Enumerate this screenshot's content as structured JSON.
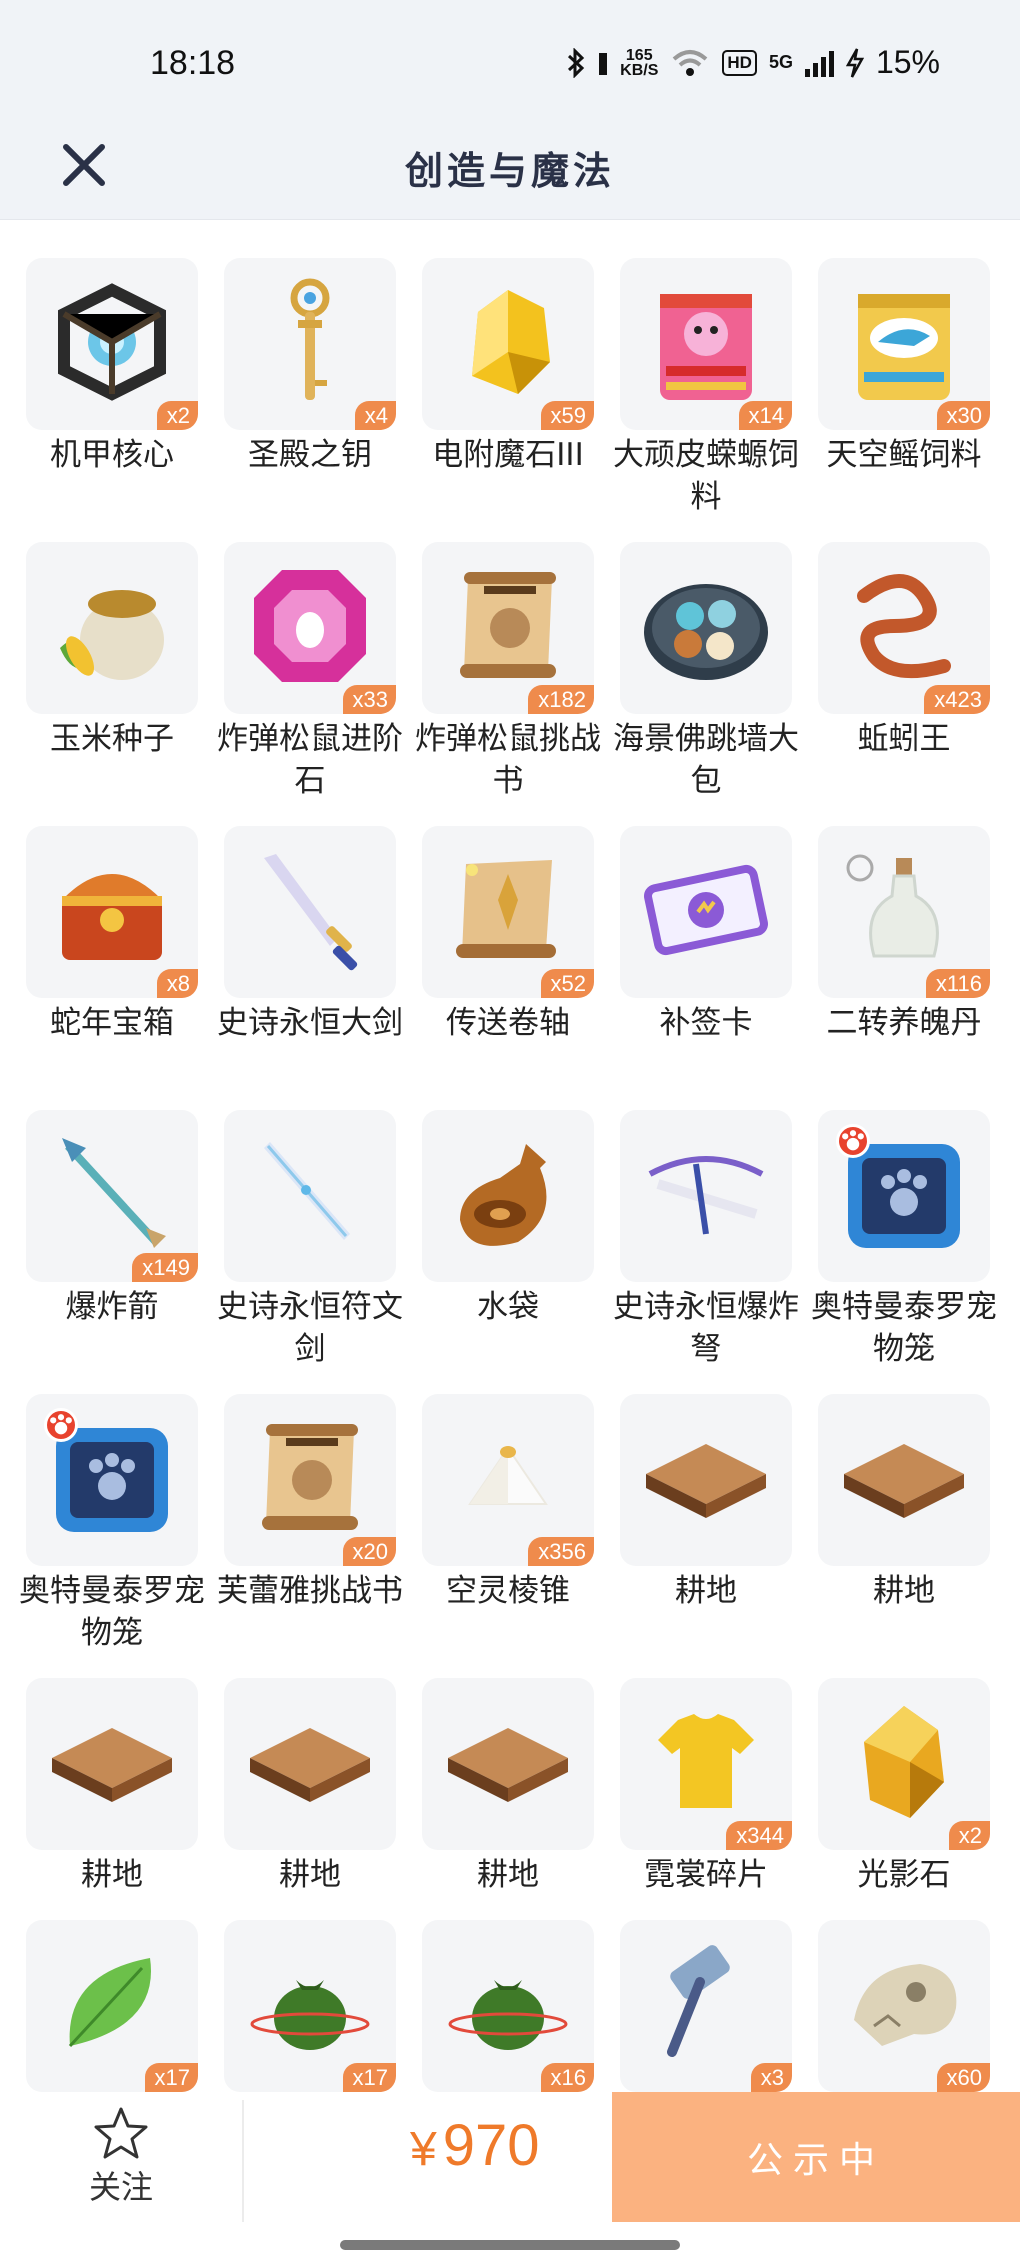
{
  "status_bar": {
    "time": "18:18",
    "net_speed_top": "165",
    "net_speed_bottom": "KB/S",
    "hd": "HD",
    "network": "5G",
    "battery": "15%"
  },
  "navbar": {
    "title": "创造与魔法"
  },
  "items": [
    {
      "name": "机甲核心",
      "count": "x2",
      "icon": "mech-core-icon"
    },
    {
      "name": "圣殿之钥",
      "count": "x4",
      "icon": "temple-key-icon"
    },
    {
      "name": "电附魔石III",
      "count": "x59",
      "icon": "enchant-stone-icon"
    },
    {
      "name": "大顽皮蝾螈饲料",
      "count": "x14",
      "icon": "feed-bag-pink-icon"
    },
    {
      "name": "天空鳐饲料",
      "count": "x30",
      "icon": "feed-bag-blue-icon"
    },
    {
      "name": "玉米种子",
      "count": "",
      "icon": "corn-seed-sack-icon"
    },
    {
      "name": "炸弹松鼠进阶石",
      "count": "x33",
      "icon": "purple-gem-icon"
    },
    {
      "name": "炸弹松鼠挑战书",
      "count": "x182",
      "icon": "wanted-scroll-icon"
    },
    {
      "name": "海景佛跳墙大包",
      "count": "",
      "icon": "food-plate-icon"
    },
    {
      "name": "蚯蚓王",
      "count": "x423",
      "icon": "worm-icon"
    },
    {
      "name": "蛇年宝箱",
      "count": "x8",
      "icon": "treasure-chest-icon"
    },
    {
      "name": "史诗永恒大剑",
      "count": "",
      "icon": "great-sword-icon"
    },
    {
      "name": "传送卷轴",
      "count": "x52",
      "icon": "teleport-scroll-icon"
    },
    {
      "name": "补签卡",
      "count": "",
      "icon": "ticket-card-icon"
    },
    {
      "name": "二转养魄丹",
      "count": "x116",
      "icon": "potion-bottle-icon"
    },
    {
      "name": "爆炸箭",
      "count": "x149",
      "icon": "arrow-icon"
    },
    {
      "name": "史诗永恒符文剑",
      "count": "",
      "icon": "rune-sword-icon"
    },
    {
      "name": "水袋",
      "count": "",
      "icon": "water-bag-icon"
    },
    {
      "name": "史诗永恒爆炸弩",
      "count": "",
      "icon": "crossbow-icon"
    },
    {
      "name": "奥特曼泰罗宠物笼",
      "count": "",
      "icon": "pet-cage-icon"
    },
    {
      "name": "奥特曼泰罗宠物笼",
      "count": "",
      "icon": "pet-cage-icon"
    },
    {
      "name": "芙蕾雅挑战书",
      "count": "x20",
      "icon": "wanted-scroll-icon"
    },
    {
      "name": "空灵棱锥",
      "count": "x356",
      "icon": "pyramid-icon"
    },
    {
      "name": "耕地",
      "count": "",
      "icon": "farmland-icon"
    },
    {
      "name": "耕地",
      "count": "",
      "icon": "farmland-icon"
    },
    {
      "name": "耕地",
      "count": "",
      "icon": "farmland-icon"
    },
    {
      "name": "耕地",
      "count": "",
      "icon": "farmland-icon"
    },
    {
      "name": "耕地",
      "count": "",
      "icon": "farmland-icon"
    },
    {
      "name": "霓裳碎片",
      "count": "x344",
      "icon": "shirt-icon"
    },
    {
      "name": "光影石",
      "count": "x2",
      "icon": "amber-stone-icon"
    },
    {
      "name": "",
      "count": "x17",
      "icon": "leaf-icon"
    },
    {
      "name": "",
      "count": "x17",
      "icon": "green-pouch-icon"
    },
    {
      "name": "",
      "count": "x16",
      "icon": "green-pouch-icon"
    },
    {
      "name": "",
      "count": "x3",
      "icon": "hammer-icon"
    },
    {
      "name": "",
      "count": "x60",
      "icon": "skull-fossil-icon"
    }
  ],
  "bottom_bar": {
    "follow_label": "关注",
    "currency": "¥",
    "price": "970",
    "action_label": "公示中"
  },
  "colors": {
    "accent": "#ef7a2a",
    "badge": "#ef8b4c",
    "cta": "#fbb280",
    "header_bg": "#f0f3f7"
  }
}
